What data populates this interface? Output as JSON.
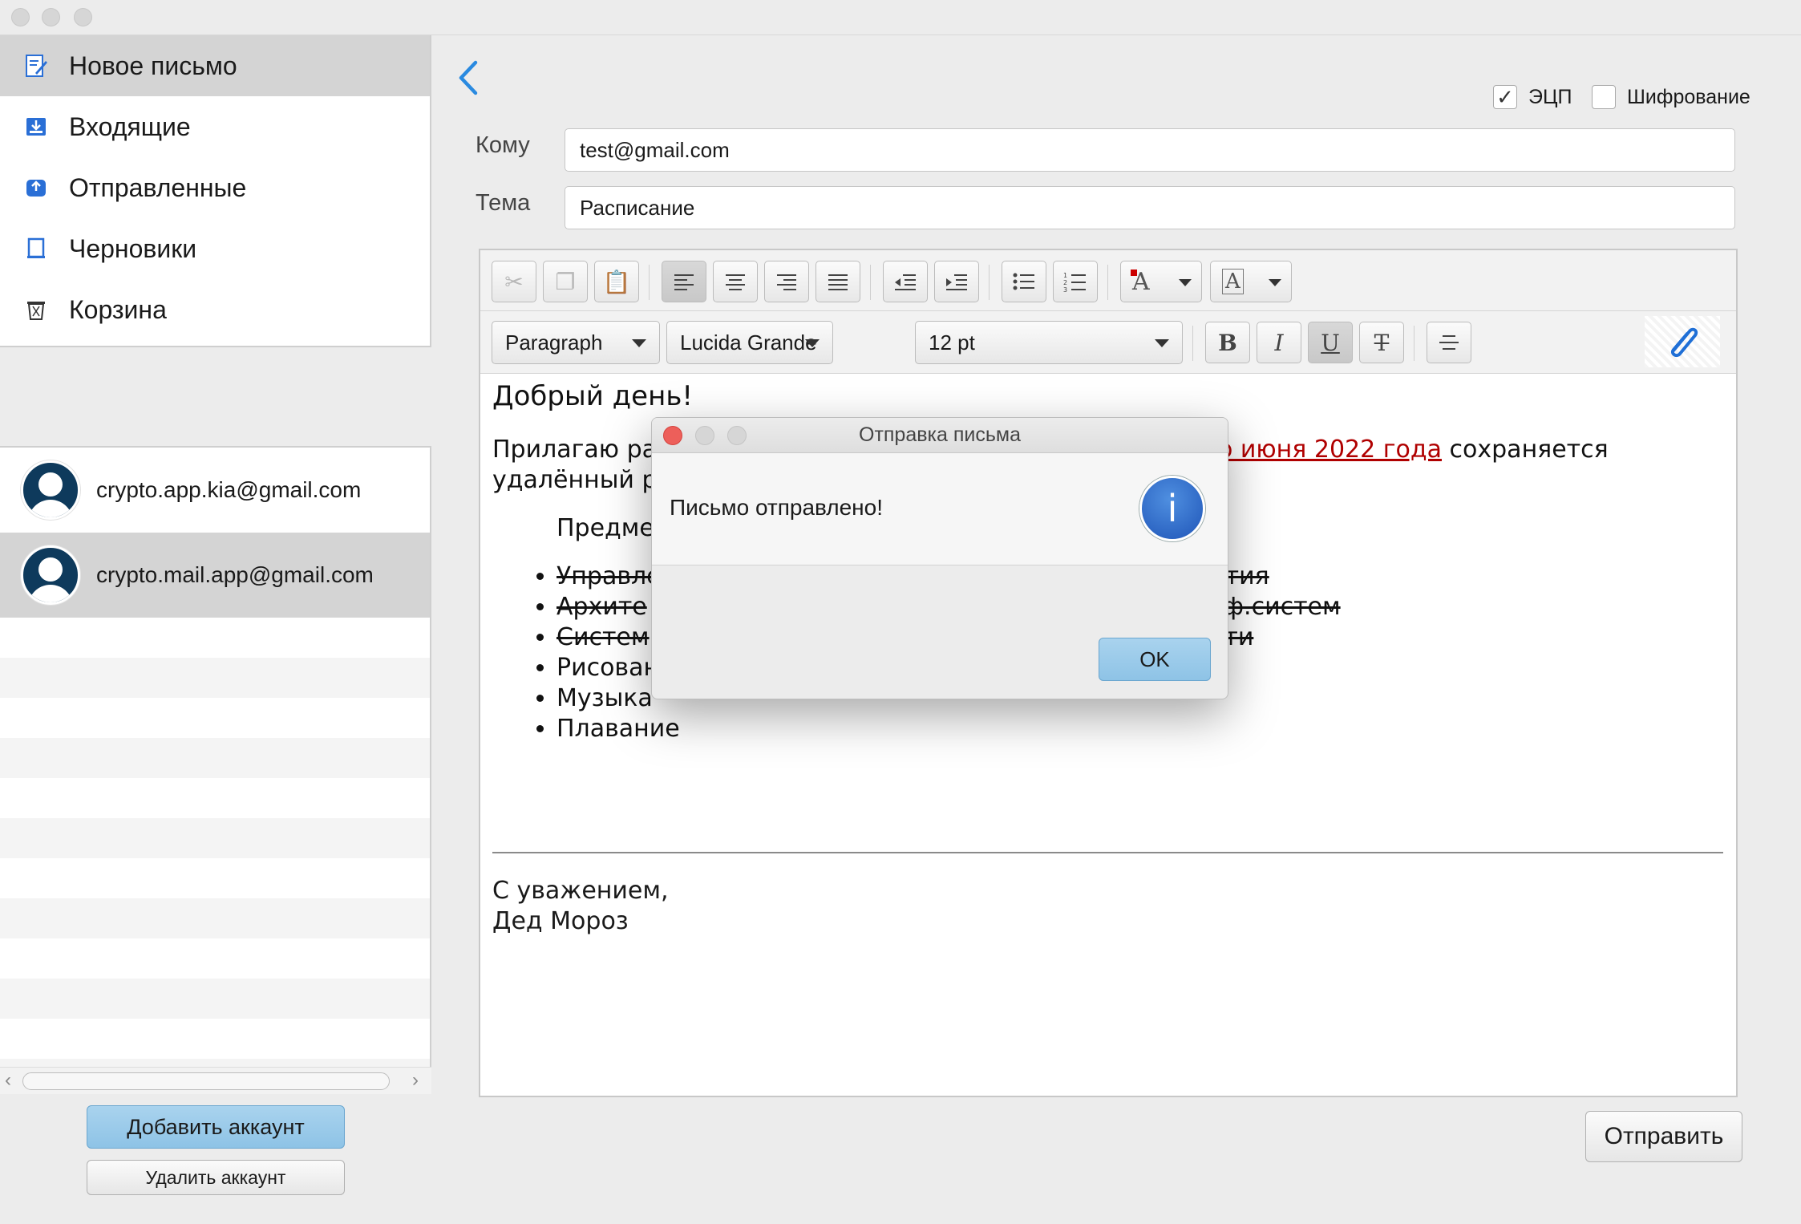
{
  "window": {
    "controls": [
      "close",
      "minimize",
      "zoom"
    ]
  },
  "sidebar": {
    "folders": [
      {
        "label": "Новое письмо",
        "icon": "compose-icon",
        "selected": true
      },
      {
        "label": "Входящие",
        "icon": "inbox-icon",
        "selected": false
      },
      {
        "label": "Отправленные",
        "icon": "outbox-icon",
        "selected": false
      },
      {
        "label": "Черновики",
        "icon": "drafts-icon",
        "selected": false
      },
      {
        "label": "Корзина",
        "icon": "trash-icon",
        "selected": false
      }
    ],
    "accounts": [
      {
        "email": "crypto.app.kia@gmail.com",
        "selected": false
      },
      {
        "email": "crypto.mail.app@gmail.com",
        "selected": true
      }
    ],
    "add_account": "Добавить аккаунт",
    "remove_account": "Удалить аккаунт"
  },
  "compose": {
    "sign_label": "ЭЦП",
    "sign_checked": true,
    "encrypt_label": "Шифрование",
    "encrypt_checked": false,
    "to_label": "Кому",
    "to_value": "test@gmail.com",
    "subject_label": "Тема",
    "subject_value": "Расписание",
    "send_label": "Отправить"
  },
  "toolbar": {
    "paragraph_style": "Paragraph",
    "font_family": "Lucida Grande",
    "font_size": "12 pt"
  },
  "body": {
    "greeting": "Добрый день!",
    "line1_start": "Прилагаю ра",
    "line1_link": "о июня 2022 года",
    "line1_end": " сохраняется",
    "line2": "удалённый р",
    "subjects_heading": "Предме",
    "items": [
      {
        "left": "Управле",
        "right": "тия",
        "strike": true
      },
      {
        "left": "Архите",
        "right": "ость инф.систем",
        "strike": true
      },
      {
        "left": "Систем",
        "right": "ости",
        "strike": true
      },
      {
        "left": "Рисование",
        "right": "",
        "strike": false
      },
      {
        "left": "Музыка",
        "right": "",
        "strike": false
      },
      {
        "left": "Плавание",
        "right": "",
        "strike": false
      }
    ],
    "sign_off": "С уважением,",
    "signature": "Дед Мороз"
  },
  "dialog": {
    "title": "Отправка письма",
    "message": "Письмо отправлено!",
    "ok": "OK",
    "icon": "info-icon"
  },
  "colors": {
    "link_red": "#b00000",
    "accent_blue": "#2a8ae0",
    "primary_button": "#8ec3e6"
  }
}
